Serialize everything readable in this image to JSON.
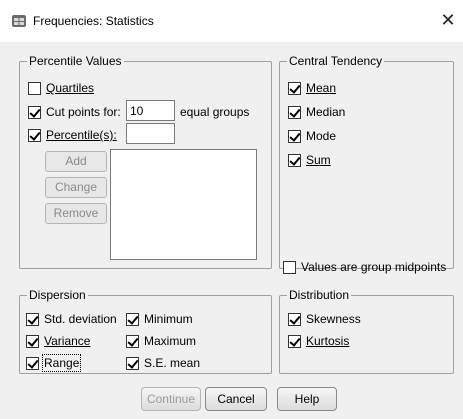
{
  "window": {
    "title": "Frequencies: Statistics",
    "close_glyph": "✕",
    "app_icon": "spss-table-icon"
  },
  "percentile_values": {
    "legend": "Percentile Values",
    "quartiles": {
      "label": "Quartiles",
      "checked": false
    },
    "cut_points": {
      "label": "Cut points for:",
      "checked": true,
      "value": "10",
      "suffix": "equal groups"
    },
    "percentiles": {
      "label": "Percentile(s):",
      "checked": true,
      "value": ""
    },
    "buttons": {
      "add": "Add",
      "change": "Change",
      "remove": "Remove"
    }
  },
  "central_tendency": {
    "legend": "Central Tendency",
    "items": [
      {
        "label": "Mean",
        "checked": true
      },
      {
        "label": "Median",
        "checked": true
      },
      {
        "label": "Mode",
        "checked": true
      },
      {
        "label": "Sum",
        "checked": true
      }
    ]
  },
  "group_midpoints": {
    "label": "Values are group midpoints",
    "checked": false
  },
  "dispersion": {
    "legend": "Dispersion",
    "items": [
      {
        "label": "Std. deviation",
        "checked": true
      },
      {
        "label": "Minimum",
        "checked": true
      },
      {
        "label": "Variance",
        "checked": true
      },
      {
        "label": "Maximum",
        "checked": true
      },
      {
        "label": "Range",
        "checked": true
      },
      {
        "label": "S.E. mean",
        "checked": true
      }
    ]
  },
  "distribution": {
    "legend": "Distribution",
    "items": [
      {
        "label": "Skewness",
        "checked": true
      },
      {
        "label": "Kurtosis",
        "checked": true
      }
    ]
  },
  "footer": {
    "continue": "Continue",
    "cancel": "Cancel",
    "help": "Help"
  }
}
